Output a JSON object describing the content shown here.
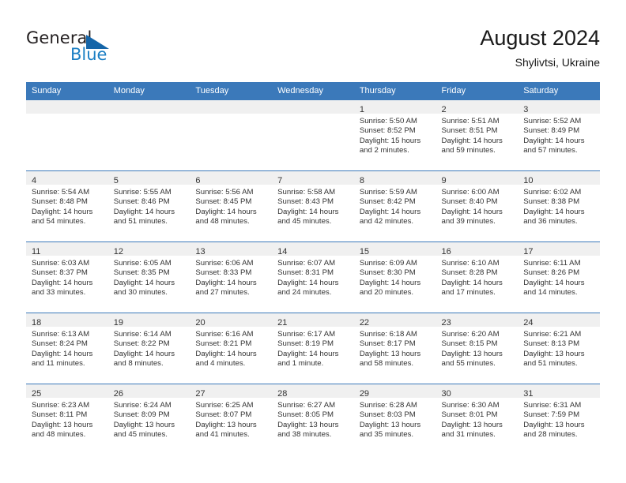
{
  "brand": {
    "name_top": "General",
    "name_bottom": "Blue",
    "accent_color": "#1c7fc4",
    "triangle_color": "#1565a8"
  },
  "header": {
    "title": "August 2024",
    "subtitle": "Shylivtsi, Ukraine",
    "header_bg": "#3b79ba"
  },
  "calendar": {
    "weekday_headers": [
      "Sunday",
      "Monday",
      "Tuesday",
      "Wednesday",
      "Thursday",
      "Friday",
      "Saturday"
    ],
    "weeks": [
      [
        {
          "empty": true
        },
        {
          "empty": true
        },
        {
          "empty": true
        },
        {
          "empty": true
        },
        {
          "day": "1",
          "sunrise": "Sunrise: 5:50 AM",
          "sunset": "Sunset: 8:52 PM",
          "daylight": "Daylight: 15 hours and 2 minutes."
        },
        {
          "day": "2",
          "sunrise": "Sunrise: 5:51 AM",
          "sunset": "Sunset: 8:51 PM",
          "daylight": "Daylight: 14 hours and 59 minutes."
        },
        {
          "day": "3",
          "sunrise": "Sunrise: 5:52 AM",
          "sunset": "Sunset: 8:49 PM",
          "daylight": "Daylight: 14 hours and 57 minutes."
        }
      ],
      [
        {
          "day": "4",
          "sunrise": "Sunrise: 5:54 AM",
          "sunset": "Sunset: 8:48 PM",
          "daylight": "Daylight: 14 hours and 54 minutes."
        },
        {
          "day": "5",
          "sunrise": "Sunrise: 5:55 AM",
          "sunset": "Sunset: 8:46 PM",
          "daylight": "Daylight: 14 hours and 51 minutes."
        },
        {
          "day": "6",
          "sunrise": "Sunrise: 5:56 AM",
          "sunset": "Sunset: 8:45 PM",
          "daylight": "Daylight: 14 hours and 48 minutes."
        },
        {
          "day": "7",
          "sunrise": "Sunrise: 5:58 AM",
          "sunset": "Sunset: 8:43 PM",
          "daylight": "Daylight: 14 hours and 45 minutes."
        },
        {
          "day": "8",
          "sunrise": "Sunrise: 5:59 AM",
          "sunset": "Sunset: 8:42 PM",
          "daylight": "Daylight: 14 hours and 42 minutes."
        },
        {
          "day": "9",
          "sunrise": "Sunrise: 6:00 AM",
          "sunset": "Sunset: 8:40 PM",
          "daylight": "Daylight: 14 hours and 39 minutes."
        },
        {
          "day": "10",
          "sunrise": "Sunrise: 6:02 AM",
          "sunset": "Sunset: 8:38 PM",
          "daylight": "Daylight: 14 hours and 36 minutes."
        }
      ],
      [
        {
          "day": "11",
          "sunrise": "Sunrise: 6:03 AM",
          "sunset": "Sunset: 8:37 PM",
          "daylight": "Daylight: 14 hours and 33 minutes."
        },
        {
          "day": "12",
          "sunrise": "Sunrise: 6:05 AM",
          "sunset": "Sunset: 8:35 PM",
          "daylight": "Daylight: 14 hours and 30 minutes."
        },
        {
          "day": "13",
          "sunrise": "Sunrise: 6:06 AM",
          "sunset": "Sunset: 8:33 PM",
          "daylight": "Daylight: 14 hours and 27 minutes."
        },
        {
          "day": "14",
          "sunrise": "Sunrise: 6:07 AM",
          "sunset": "Sunset: 8:31 PM",
          "daylight": "Daylight: 14 hours and 24 minutes."
        },
        {
          "day": "15",
          "sunrise": "Sunrise: 6:09 AM",
          "sunset": "Sunset: 8:30 PM",
          "daylight": "Daylight: 14 hours and 20 minutes."
        },
        {
          "day": "16",
          "sunrise": "Sunrise: 6:10 AM",
          "sunset": "Sunset: 8:28 PM",
          "daylight": "Daylight: 14 hours and 17 minutes."
        },
        {
          "day": "17",
          "sunrise": "Sunrise: 6:11 AM",
          "sunset": "Sunset: 8:26 PM",
          "daylight": "Daylight: 14 hours and 14 minutes."
        }
      ],
      [
        {
          "day": "18",
          "sunrise": "Sunrise: 6:13 AM",
          "sunset": "Sunset: 8:24 PM",
          "daylight": "Daylight: 14 hours and 11 minutes."
        },
        {
          "day": "19",
          "sunrise": "Sunrise: 6:14 AM",
          "sunset": "Sunset: 8:22 PM",
          "daylight": "Daylight: 14 hours and 8 minutes."
        },
        {
          "day": "20",
          "sunrise": "Sunrise: 6:16 AM",
          "sunset": "Sunset: 8:21 PM",
          "daylight": "Daylight: 14 hours and 4 minutes."
        },
        {
          "day": "21",
          "sunrise": "Sunrise: 6:17 AM",
          "sunset": "Sunset: 8:19 PM",
          "daylight": "Daylight: 14 hours and 1 minute."
        },
        {
          "day": "22",
          "sunrise": "Sunrise: 6:18 AM",
          "sunset": "Sunset: 8:17 PM",
          "daylight": "Daylight: 13 hours and 58 minutes."
        },
        {
          "day": "23",
          "sunrise": "Sunrise: 6:20 AM",
          "sunset": "Sunset: 8:15 PM",
          "daylight": "Daylight: 13 hours and 55 minutes."
        },
        {
          "day": "24",
          "sunrise": "Sunrise: 6:21 AM",
          "sunset": "Sunset: 8:13 PM",
          "daylight": "Daylight: 13 hours and 51 minutes."
        }
      ],
      [
        {
          "day": "25",
          "sunrise": "Sunrise: 6:23 AM",
          "sunset": "Sunset: 8:11 PM",
          "daylight": "Daylight: 13 hours and 48 minutes."
        },
        {
          "day": "26",
          "sunrise": "Sunrise: 6:24 AM",
          "sunset": "Sunset: 8:09 PM",
          "daylight": "Daylight: 13 hours and 45 minutes."
        },
        {
          "day": "27",
          "sunrise": "Sunrise: 6:25 AM",
          "sunset": "Sunset: 8:07 PM",
          "daylight": "Daylight: 13 hours and 41 minutes."
        },
        {
          "day": "28",
          "sunrise": "Sunrise: 6:27 AM",
          "sunset": "Sunset: 8:05 PM",
          "daylight": "Daylight: 13 hours and 38 minutes."
        },
        {
          "day": "29",
          "sunrise": "Sunrise: 6:28 AM",
          "sunset": "Sunset: 8:03 PM",
          "daylight": "Daylight: 13 hours and 35 minutes."
        },
        {
          "day": "30",
          "sunrise": "Sunrise: 6:30 AM",
          "sunset": "Sunset: 8:01 PM",
          "daylight": "Daylight: 13 hours and 31 minutes."
        },
        {
          "day": "31",
          "sunrise": "Sunrise: 6:31 AM",
          "sunset": "Sunset: 7:59 PM",
          "daylight": "Daylight: 13 hours and 28 minutes."
        }
      ]
    ]
  }
}
